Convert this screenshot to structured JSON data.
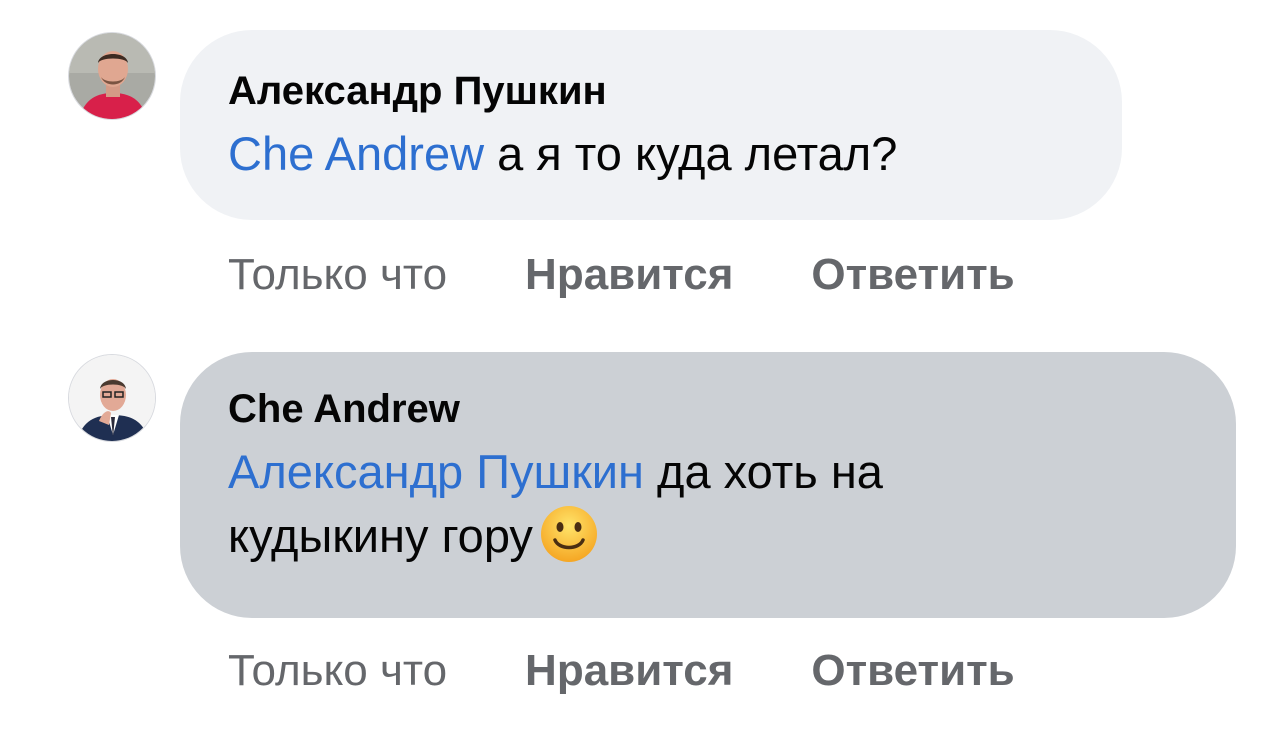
{
  "comments": [
    {
      "author": "Александр Пушкин",
      "mention": "Che Andrew",
      "text": " а я то куда летал?",
      "time": "Только что",
      "like_label": "Нравится",
      "reply_label": "Ответить"
    },
    {
      "author": "Che Andrew",
      "mention": "Александр Пушкин",
      "text_line1": " да хоть на",
      "text_line2": "кудыкину гору",
      "emoji": "slightly-smiling-face",
      "time": "Только что",
      "like_label": "Нравится",
      "reply_label": "Ответить"
    }
  ],
  "colors": {
    "bubble_light": "#f0f2f5",
    "bubble_selected": "#ccd0d5",
    "mention": "#2d6fd0",
    "meta": "#65676b"
  }
}
